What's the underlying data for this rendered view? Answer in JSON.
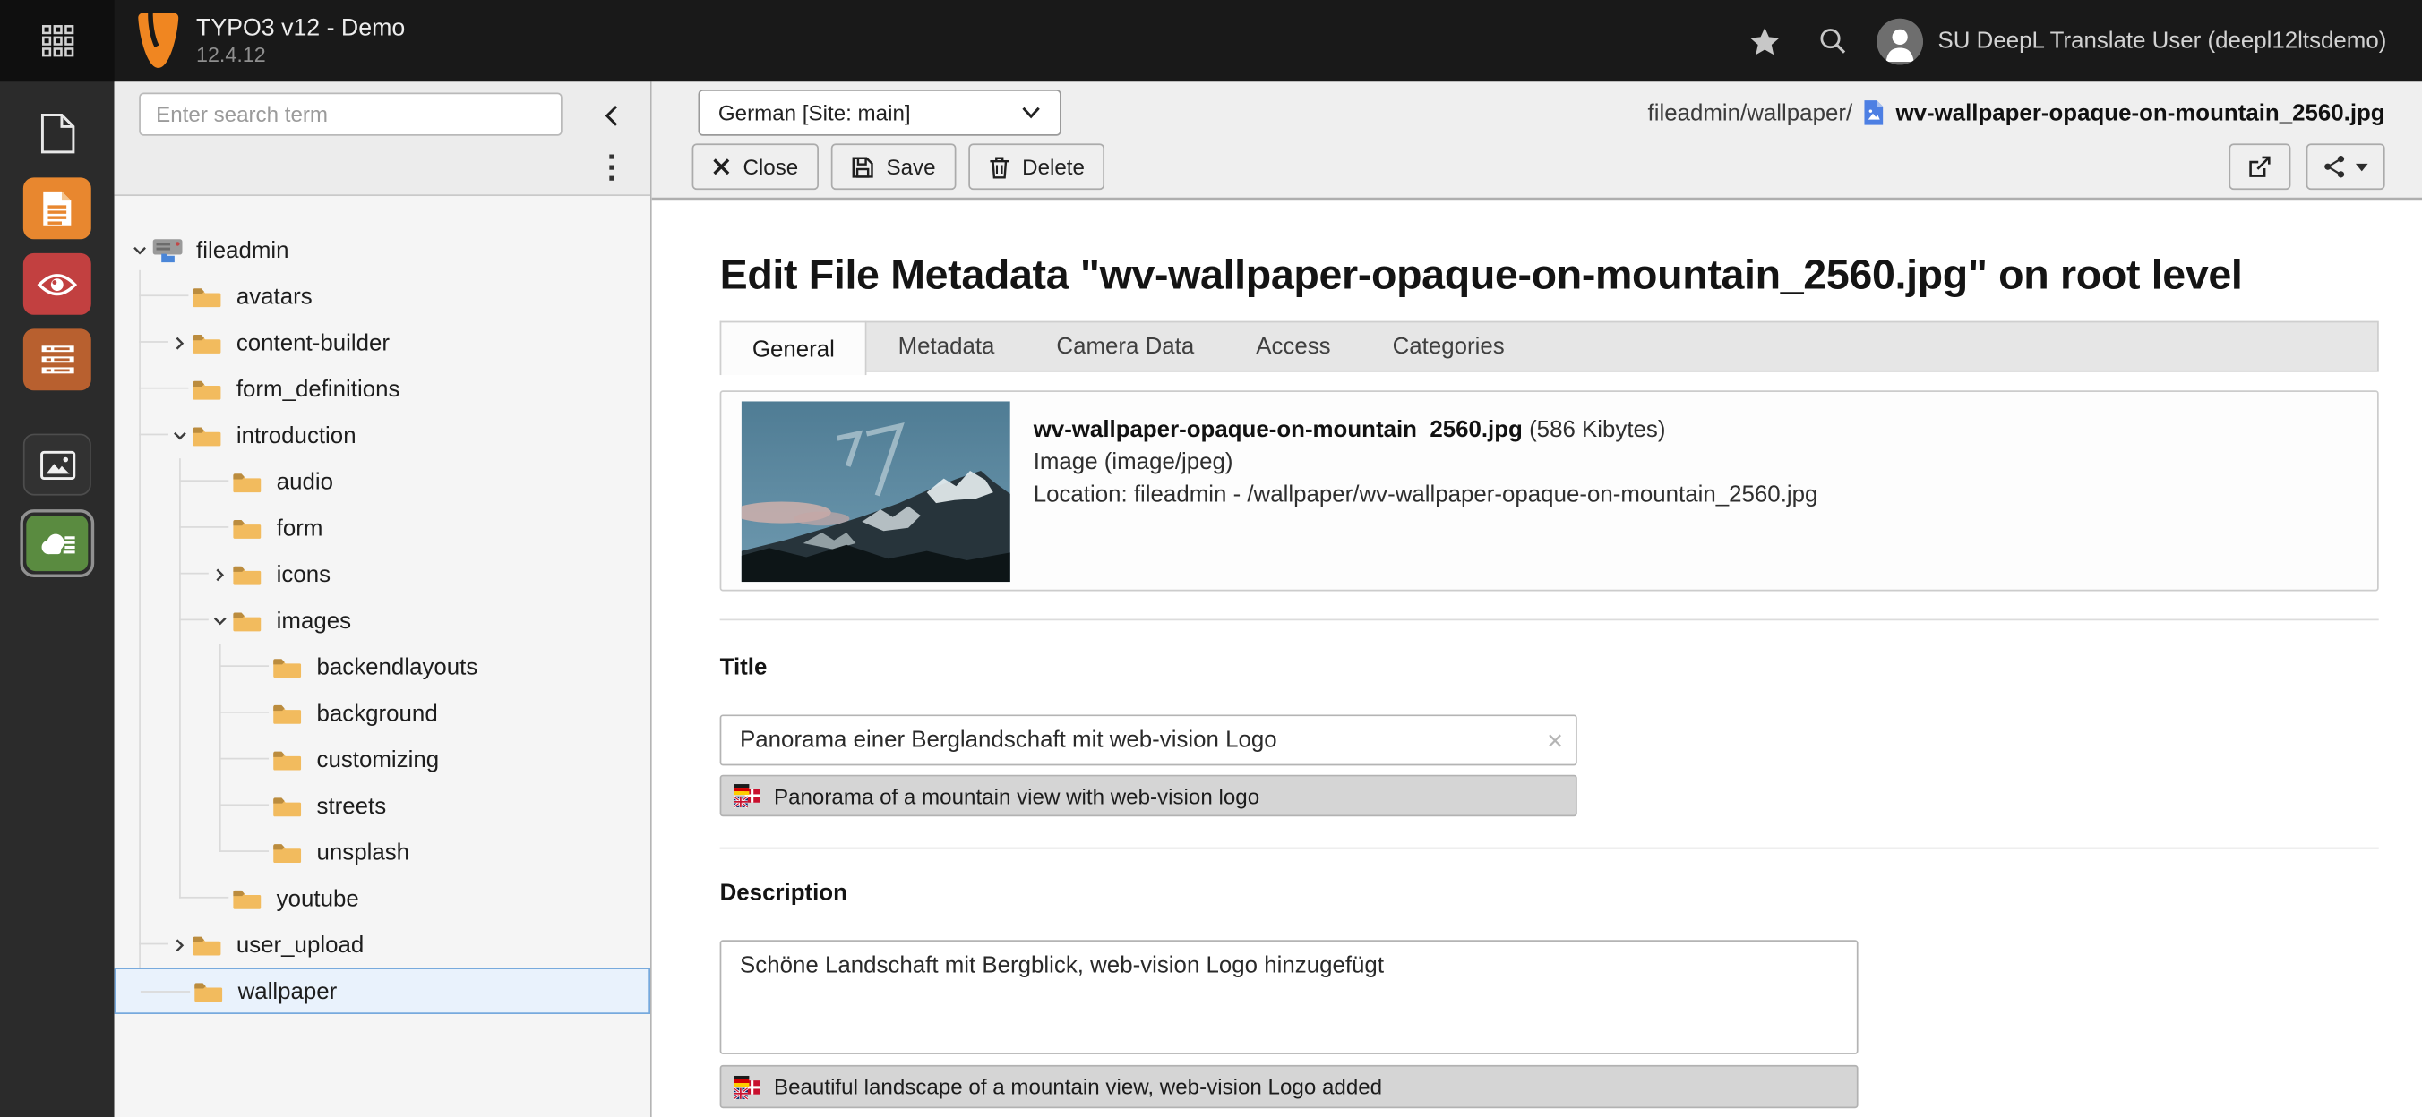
{
  "topbar": {
    "title": "TYPO3 v12 - Demo",
    "version": "12.4.12",
    "username": "SU DeepL Translate User (deepl12ltsdemo)",
    "icons": [
      "modulemenu-grid-icon",
      "typo3-logo",
      "bookmark-star-icon",
      "search-icon",
      "user-avatar"
    ]
  },
  "modulebar": {
    "items": [
      {
        "icon": "page-outline-icon",
        "tile": "none",
        "active": false
      },
      {
        "icon": "page-document-icon",
        "tile": "orange",
        "active": false
      },
      {
        "icon": "view-eye-icon",
        "tile": "red",
        "active": false
      },
      {
        "icon": "list-icon",
        "tile": "rust",
        "active": false
      },
      {
        "icon": "filelist-image-icon",
        "tile": "dark",
        "active": false
      },
      {
        "icon": "media-cloud-icon",
        "tile": "green",
        "active": true
      }
    ]
  },
  "tree": {
    "search_placeholder": "Enter search term",
    "items": [
      {
        "label": "fileadmin",
        "level": 0,
        "expander": "down",
        "icon": "storage",
        "selected": false
      },
      {
        "label": "avatars",
        "level": 1,
        "expander": "none",
        "icon": "folder",
        "selected": false
      },
      {
        "label": "content-builder",
        "level": 1,
        "expander": "right",
        "icon": "folder",
        "selected": false
      },
      {
        "label": "form_definitions",
        "level": 1,
        "expander": "none",
        "icon": "folder",
        "selected": false
      },
      {
        "label": "introduction",
        "level": 1,
        "expander": "down",
        "icon": "folder",
        "selected": false
      },
      {
        "label": "audio",
        "level": 2,
        "expander": "none",
        "icon": "folder",
        "selected": false
      },
      {
        "label": "form",
        "level": 2,
        "expander": "none",
        "icon": "folder",
        "selected": false
      },
      {
        "label": "icons",
        "level": 2,
        "expander": "right",
        "icon": "folder",
        "selected": false
      },
      {
        "label": "images",
        "level": 2,
        "expander": "down",
        "icon": "folder",
        "selected": false
      },
      {
        "label": "backendlayouts",
        "level": 3,
        "expander": "none",
        "icon": "folder",
        "selected": false
      },
      {
        "label": "background",
        "level": 3,
        "expander": "none",
        "icon": "folder",
        "selected": false
      },
      {
        "label": "customizing",
        "level": 3,
        "expander": "none",
        "icon": "folder",
        "selected": false
      },
      {
        "label": "streets",
        "level": 3,
        "expander": "none",
        "icon": "folder",
        "selected": false
      },
      {
        "label": "unsplash",
        "level": 3,
        "expander": "none",
        "icon": "folder",
        "selected": false
      },
      {
        "label": "youtube",
        "level": 2,
        "expander": "none",
        "icon": "folder",
        "selected": false
      },
      {
        "label": "user_upload",
        "level": 1,
        "expander": "right",
        "icon": "folder",
        "selected": false
      },
      {
        "label": "wallpaper",
        "level": 1,
        "expander": "none",
        "icon": "folder",
        "selected": true
      }
    ]
  },
  "docheader": {
    "language": "German [Site: main]",
    "buttons": {
      "close": "Close",
      "save": "Save",
      "delete": "Delete"
    },
    "path": "fileadmin/wallpaper/",
    "filename": "wv-wallpaper-opaque-on-mountain_2560.jpg"
  },
  "main": {
    "heading": "Edit File Metadata \"wv-wallpaper-opaque-on-mountain_2560.jpg\" on root level",
    "tabs": [
      "General",
      "Metadata",
      "Camera Data",
      "Access",
      "Categories"
    ],
    "active_tab_index": 0,
    "file_info": {
      "filename": "wv-wallpaper-opaque-on-mountain_2560.jpg",
      "size": "(586 Kibytes)",
      "mime": "Image (image/jpeg)",
      "location": "Location: fileadmin - /wallpaper/wv-wallpaper-opaque-on-mountain_2560.jpg"
    },
    "title": {
      "label": "Title",
      "value": "Panorama einer Berglandschaft mit web-vision Logo",
      "translation": "Panorama of a mountain view with web-vision logo"
    },
    "description": {
      "label": "Description",
      "value": "Schöne Landschaft mit Bergblick, web-vision Logo hinzugefügt",
      "translation": "Beautiful landscape of a mountain view, web-vision Logo added"
    }
  },
  "colors": {
    "typo3_orange": "#ff8700",
    "topbar_bg": "#191919",
    "modulebar_bg": "#2b2b2b",
    "active_module_green": "#5a8b40",
    "selected_row_bg": "#e9f2fc",
    "selected_row_border": "#76a9dd",
    "translation_bar_bg": "#d5d5d5"
  }
}
